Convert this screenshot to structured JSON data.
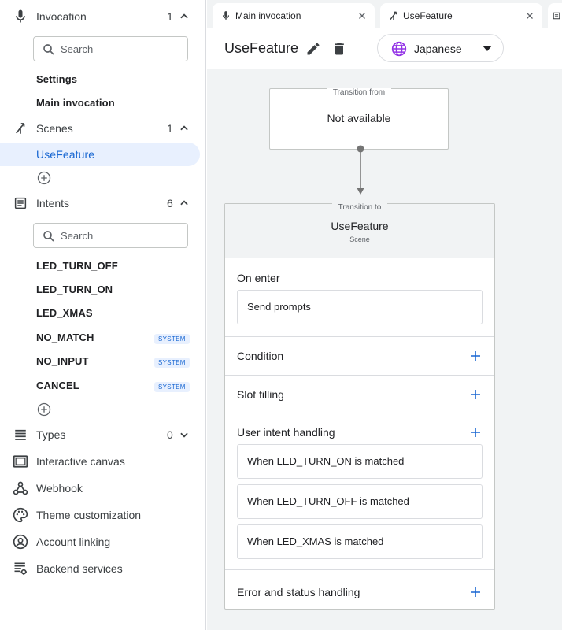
{
  "sidebar": {
    "invocation": {
      "label": "Invocation",
      "count": "1",
      "search_placeholder": "Search",
      "items": [
        "Settings",
        "Main invocation"
      ]
    },
    "scenes": {
      "label": "Scenes",
      "count": "1",
      "items": [
        "UseFeature"
      ]
    },
    "intents": {
      "label": "Intents",
      "count": "6",
      "search_placeholder": "Search",
      "items": [
        {
          "label": "LED_TURN_OFF",
          "badge": ""
        },
        {
          "label": "LED_TURN_ON",
          "badge": ""
        },
        {
          "label": "LED_XMAS",
          "badge": ""
        },
        {
          "label": "NO_MATCH",
          "badge": "SYSTEM"
        },
        {
          "label": "NO_INPUT",
          "badge": "SYSTEM"
        },
        {
          "label": "CANCEL",
          "badge": "SYSTEM"
        }
      ]
    },
    "types": {
      "label": "Types",
      "count": "0"
    },
    "nav": [
      "Interactive canvas",
      "Webhook",
      "Theme customization",
      "Account linking",
      "Backend services"
    ]
  },
  "tabs": [
    {
      "label": "Main invocation",
      "icon": "mic-icon"
    },
    {
      "label": "UseFeature",
      "icon": "scene-icon"
    }
  ],
  "header": {
    "title": "UseFeature",
    "language": "Japanese"
  },
  "transition_from": {
    "caption": "Transition from",
    "value": "Not available"
  },
  "scene_card": {
    "caption": "Transition to",
    "name": "UseFeature",
    "type": "Scene",
    "on_enter": {
      "title": "On enter",
      "prompt": "Send prompts"
    },
    "condition": "Condition",
    "slot_filling": "Slot filling",
    "user_intent": {
      "title": "User intent handling",
      "handlers": [
        "When LED_TURN_ON is matched",
        "When LED_TURN_OFF is matched",
        "When LED_XMAS is matched"
      ]
    },
    "error_handling": "Error and status handling"
  },
  "colors": {
    "accent": "#1967d2",
    "selected_bg": "#e8f0fe",
    "globe": "#9334e6"
  }
}
